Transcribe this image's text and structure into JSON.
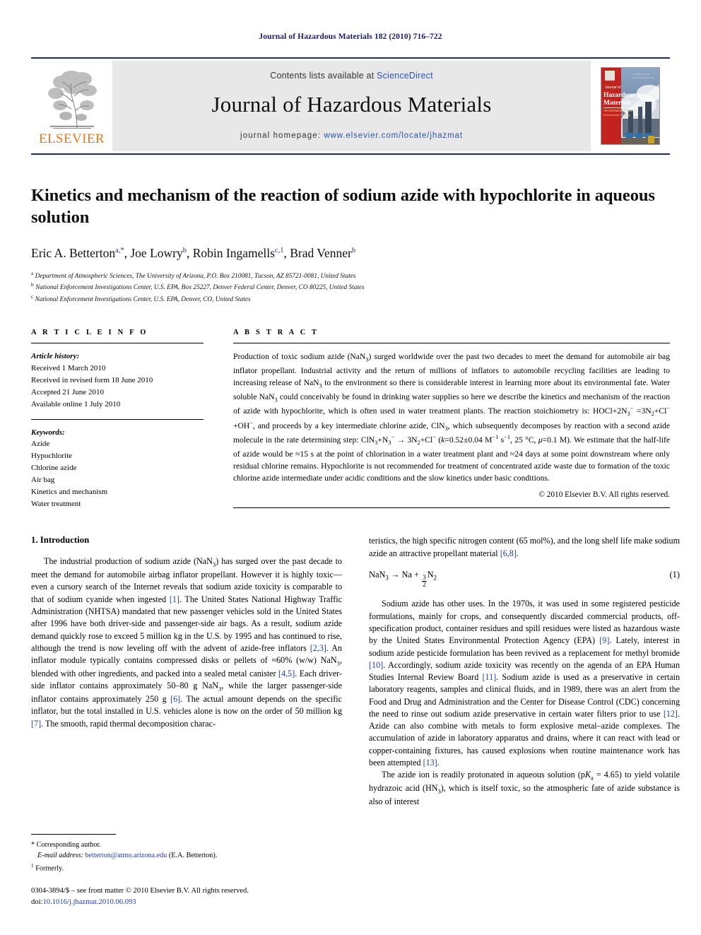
{
  "running_head": "Journal of Hazardous Materials 182 (2010) 716–722",
  "masthead": {
    "contents_prefix": "Contents lists available at ",
    "sciencedirect": "ScienceDirect",
    "journal_name": "Journal of Hazardous Materials",
    "homepage_label": "journal homepage:",
    "homepage_url": "www.elsevier.com/locate/jhazmat",
    "publisher": "ELSEVIER",
    "cover_title_small": "Journal of",
    "cover_title_1": "Hazardous",
    "cover_title_2": "Materials",
    "accent_blue": "#2b54b0",
    "rule_blue": "#1d2a6b",
    "elsevier_orange": "#E87722"
  },
  "article": {
    "title": "Kinetics and mechanism of the reaction of sodium azide with hypochlorite in aqueous solution",
    "authors_html": "Eric A. Betterton<sup>a,*</sup>, Joe Lowry<sup>b</sup>, Robin Ingamells<sup>c,1</sup>, Brad Venner<sup>b</sup>",
    "affiliations": [
      "Department of Atmospheric Sciences, The University of Arizona, P.O. Box 210081, Tucson, AZ 85721-0081, United States",
      "National Enforcement Investigations Center, U.S. EPA, Box 25227, Denver Federal Center, Denver, CO 80225, United States",
      "National Enforcement Investigations Center, U.S. EPA, Denver, CO, United States"
    ],
    "affiliation_marks": [
      "a",
      "b",
      "c"
    ]
  },
  "info": {
    "heading": "A R T I C L E    I N F O",
    "history_label": "Article history:",
    "history": [
      "Received 1 March 2010",
      "Received in revised form 18 June 2010",
      "Accepted 21 June 2010",
      "Available online 1 July 2010"
    ],
    "keywords_label": "Keywords:",
    "keywords": [
      "Azide",
      "Hypochlorite",
      "Chlorine azide",
      "Air bag",
      "Kinetics and mechanism",
      "Water treatment"
    ]
  },
  "abstract": {
    "heading": "A B S T R A C T",
    "text_html": "Production of toxic sodium azide (NaN<sub>3</sub>) surged worldwide over the past two decades to meet the demand for automobile air bag inflator propellant. Industrial activity and the return of millions of inflators to automobile recycling facilities are leading to increasing release of NaN<sub>3</sub> to the environment so there is considerable interest in learning more about its environmental fate. Water soluble NaN<sub>3</sub> could conceivably be found in drinking water supplies so here we describe the kinetics and mechanism of the reaction of azide with hypochlorite, which is often used in water treatment plants. The reaction stoichiometry is: HOCl+2N<sub>3</sub><sup>−</sup> =3N<sub>2</sub>+Cl<sup>−</sup>+OH<sup>−</sup>, and proceeds by a key intermediate chlorine azide, ClN<sub>3</sub>, which subsequently decomposes by reaction with a second azide molecule in the rate determining step: ClN<sub>3</sub>+N<sub>3</sub><sup>−</sup> → 3N<sub>2</sub>+Cl<sup>−</sup> (<i>k</i>=0.52±0.04 M<sup>−1</sup> s<sup>−1</sup>, 25 °C, <i>μ</i>=0.1 M). We estimate that the half-life of azide would be ≈15 s at the point of chlorination in a water treatment plant and ≈24 days at some point downstream where only residual chlorine remains. Hypochlorite is not recommended for treatment of concentrated azide waste due to formation of the toxic chlorine azide intermediate under acidic conditions and the slow kinetics under basic conditions.",
    "copyright": "© 2010 Elsevier B.V. All rights reserved."
  },
  "body": {
    "section1_heading": "1.  Introduction",
    "left_p1_html": "The industrial production of sodium azide (NaN<sub>3</sub>) has surged over the past decade to meet the demand for automobile airbag inflator propellant. However it is highly toxic—even a cursory search of the Internet reveals that sodium azide toxicity is comparable to that of sodium cyanide when ingested <span class=\"cite\">[1]</span>. The United States National Highway Traffic Administration (NHTSA) mandated that new passenger vehicles sold in the United States after 1996 have both driver-side and passenger-side air bags. As a result, sodium azide demand quickly rose to exceed 5 million kg in the U.S. by 1995 and has continued to rise, although the trend is now leveling off with the advent of azide-free inflators <span class=\"cite\">[2,3]</span>. An inflator module typically contains compressed disks or pellets of ≈60% (w/w) NaN<sub>3</sub>, blended with other ingredients, and packed into a sealed metal canister <span class=\"cite\">[4,5]</span>. Each driver-side inflator contains approximately 50–80 g NaN<sub>3</sub>, while the larger passenger-side inflator contains approximately 250 g <span class=\"cite\">[6]</span>. The actual amount depends on the specific inflator, but the total installed in U.S. vehicles alone is now on the order of 50 million kg <span class=\"cite\">[7]</span>. The smooth, rapid thermal decomposition charac-",
    "right_p1_html": "teristics, the high specific nitrogen content (65 mol%), and the long shelf life make sodium azide an attractive propellant material <span class=\"cite\">[6,8]</span>.",
    "equation_1_html": "NaN<sub>3</sub> → Na + <span class=\"frac\"><span class=\"num\">3</span><span class=\"den\">2</span></span>N<sub>2</sub>",
    "equation_1_number": "(1)",
    "right_p2_html": "Sodium azide has other uses. In the 1970s, it was used in some registered pesticide formulations, mainly for crops, and consequently discarded commercial products, off-specification product, container residues and spill residues were listed as hazardous waste by the United States Environmental Protection Agency (EPA) <span class=\"cite\">[9]</span>. Lately, interest in sodium azide pesticide formulation has been revived as a replacement for methyl bromide <span class=\"cite\">[10]</span>. Accordingly, sodium azide toxicity was recently on the agenda of an EPA Human Studies Internal Review Board <span class=\"cite\">[11]</span>. Sodium azide is used as a preservative in certain laboratory reagents, samples and clinical fluids, and in 1989, there was an alert from the Food and Drug and Administration and the Center for Disease Control (CDC) concerning the need to rinse out sodium azide preservative in certain water filters prior to use <span class=\"cite\">[12]</span>. Azide can also combine with metals to form explosive metal–azide complexes. The accumulation of azide in laboratory apparatus and drains, where it can react with lead or copper-containing fixtures, has caused explosions when routine maintenance work has been attempted <span class=\"cite\">[13]</span>.",
    "right_p3_html": "The azide ion is readily protonated in aqueous solution (p<i>K</i><sub>a</sub> = 4.65) to yield volatile hydrazoic acid (HN<sub>3</sub>), which is itself toxic, so the atmospheric fate of azide substance is also of interest"
  },
  "footnotes": {
    "corresponding": "* Corresponding author.",
    "email_label": "E-mail address:",
    "email": "betterton@atmo.arizona.edu",
    "email_suffix": "(E.A. Betterton).",
    "formerly_mark": "1",
    "formerly": "Formerly.",
    "imprint_line1": "0304-3894/$ – see front matter © 2010 Elsevier B.V. All rights reserved.",
    "doi_label": "doi:",
    "doi": "10.1016/j.jhazmat.2010.06.093"
  }
}
